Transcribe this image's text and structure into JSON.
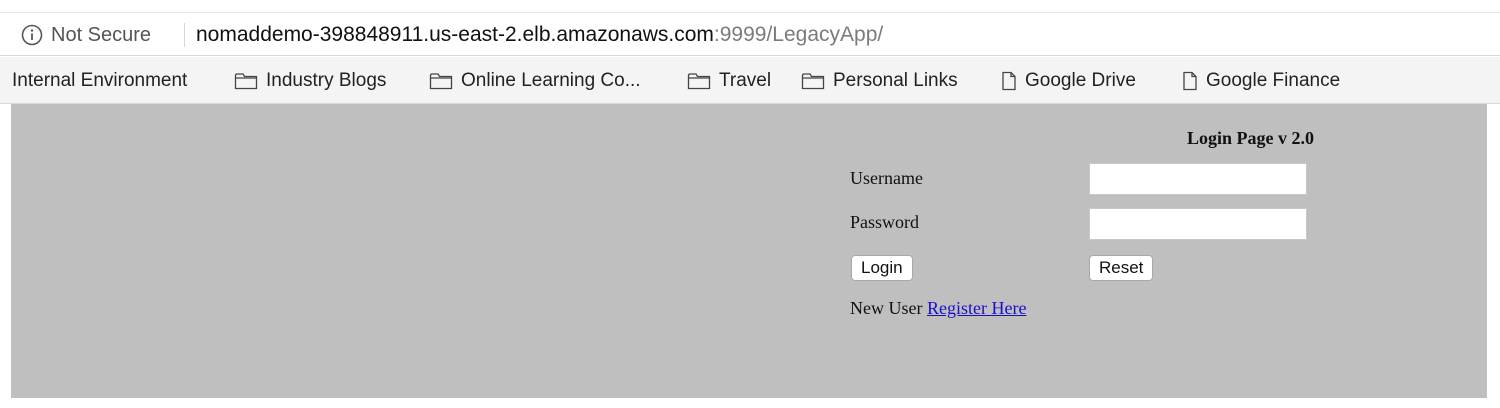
{
  "address_bar": {
    "security_label": "Not Secure",
    "url_host": "nomaddemo-398848911.us-east-2.elb.amazonaws.com",
    "url_rest": ":9999/LegacyApp/"
  },
  "bookmarks": [
    {
      "label": "Internal Environment",
      "icon": "none"
    },
    {
      "label": "Industry Blogs",
      "icon": "folder-icon"
    },
    {
      "label": "Online Learning Co...",
      "icon": "folder-icon"
    },
    {
      "label": "Travel",
      "icon": "folder-icon"
    },
    {
      "label": "Personal Links",
      "icon": "folder-icon"
    },
    {
      "label": "Google Drive",
      "icon": "page-icon"
    },
    {
      "label": "Google Finance",
      "icon": "page-icon"
    }
  ],
  "login": {
    "title": "Login Page v 2.0",
    "username_label": "Username",
    "username_value": "",
    "password_label": "Password",
    "password_value": "",
    "login_button": "Login",
    "reset_button": "Reset",
    "new_user_text": "New User",
    "register_link": "Register Here"
  },
  "colors": {
    "page_background": "#bfbfbf",
    "link": "#1a0dcc",
    "bookmark_bar": "#f4f4f4"
  }
}
